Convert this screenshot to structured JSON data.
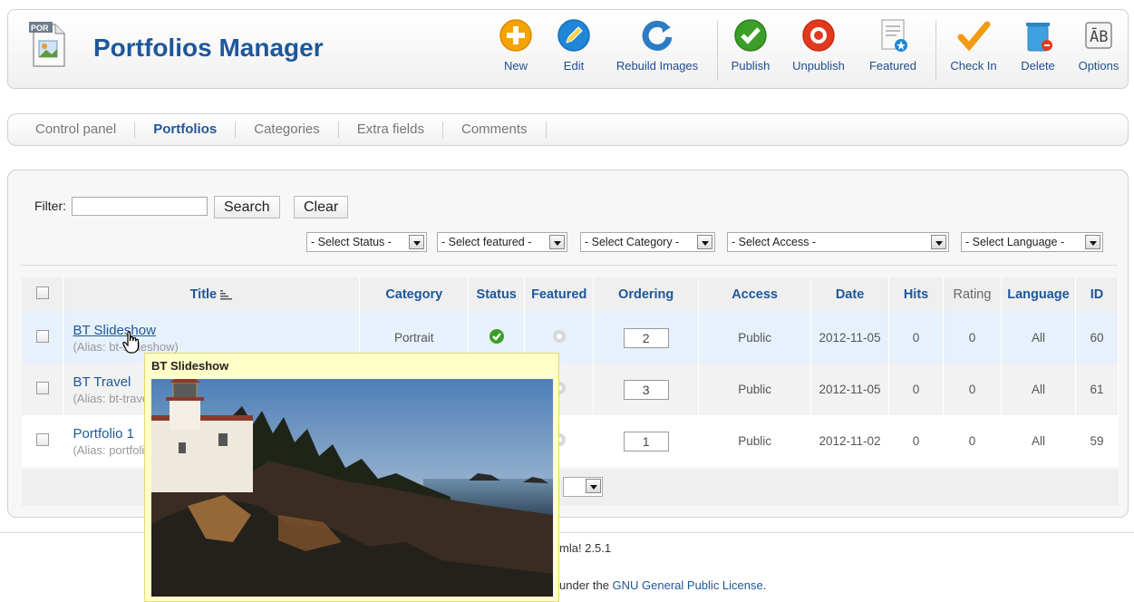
{
  "app": {
    "title": "Portfolios Manager",
    "icon_badge": "POR"
  },
  "toolbar": {
    "buttons": [
      {
        "label": "New",
        "icon": "plus-icon",
        "color": "#f5a300"
      },
      {
        "label": "Edit",
        "icon": "pencil-icon",
        "color": "#1f86d8"
      },
      {
        "label": "Rebuild Images",
        "icon": "refresh-icon",
        "color": "#2b7cc4"
      },
      {
        "label": "Publish",
        "icon": "check-circle-icon",
        "color": "#3b9e28"
      },
      {
        "label": "Unpublish",
        "icon": "stop-circle-icon",
        "color": "#e2391e"
      },
      {
        "label": "Featured",
        "icon": "featured-doc-icon",
        "color": "#1f86d8"
      },
      {
        "label": "Check In",
        "icon": "checkmark-icon",
        "color": "#f29a10"
      },
      {
        "label": "Delete",
        "icon": "trash-icon",
        "color": "#3fa0e0"
      },
      {
        "label": "Options",
        "icon": "options-icon",
        "color": "#666666"
      }
    ]
  },
  "submenu": {
    "tabs": [
      "Control panel",
      "Portfolios",
      "Categories",
      "Extra fields",
      "Comments"
    ],
    "active": "Portfolios"
  },
  "filters": {
    "filter_label": "Filter:",
    "filter_value": "",
    "search_label": "Search",
    "clear_label": "Clear",
    "status": "- Select Status -",
    "featured": "- Select featured -",
    "category": "- Select Category -",
    "access": "- Select Access -",
    "language": "- Select Language -"
  },
  "table": {
    "columns": [
      "Title",
      "Category",
      "Status",
      "Featured",
      "Ordering",
      "Access",
      "Date",
      "Hits",
      "Rating",
      "Language",
      "ID"
    ],
    "rows": [
      {
        "title": "BT Slideshow",
        "alias": "(Alias: bt-slideshow)",
        "category": "Portrait",
        "status": "published",
        "featured": "no",
        "ordering": "2",
        "access": "Public",
        "date": "2012-11-05",
        "hits": "0",
        "rating": "0",
        "language": "All",
        "id": "60"
      },
      {
        "title": "BT Travel",
        "alias": "(Alias: bt-travel)",
        "category": "",
        "status": "",
        "featured": "no",
        "ordering": "3",
        "access": "Public",
        "date": "2012-11-05",
        "hits": "0",
        "rating": "0",
        "language": "All",
        "id": "61"
      },
      {
        "title": "Portfolio 1",
        "alias": "(Alias: portfolio-1)",
        "category": "",
        "status": "",
        "featured": "no",
        "ordering": "1",
        "access": "Public",
        "date": "2012-11-02",
        "hits": "0",
        "rating": "0",
        "language": "All",
        "id": "59"
      }
    ]
  },
  "footer": {
    "powered": "mla! 2.5.1",
    "license_prefix": "under the ",
    "license_link": "GNU General Public License",
    "license_suffix": "."
  },
  "tooltip": {
    "title": "BT Slideshow"
  }
}
